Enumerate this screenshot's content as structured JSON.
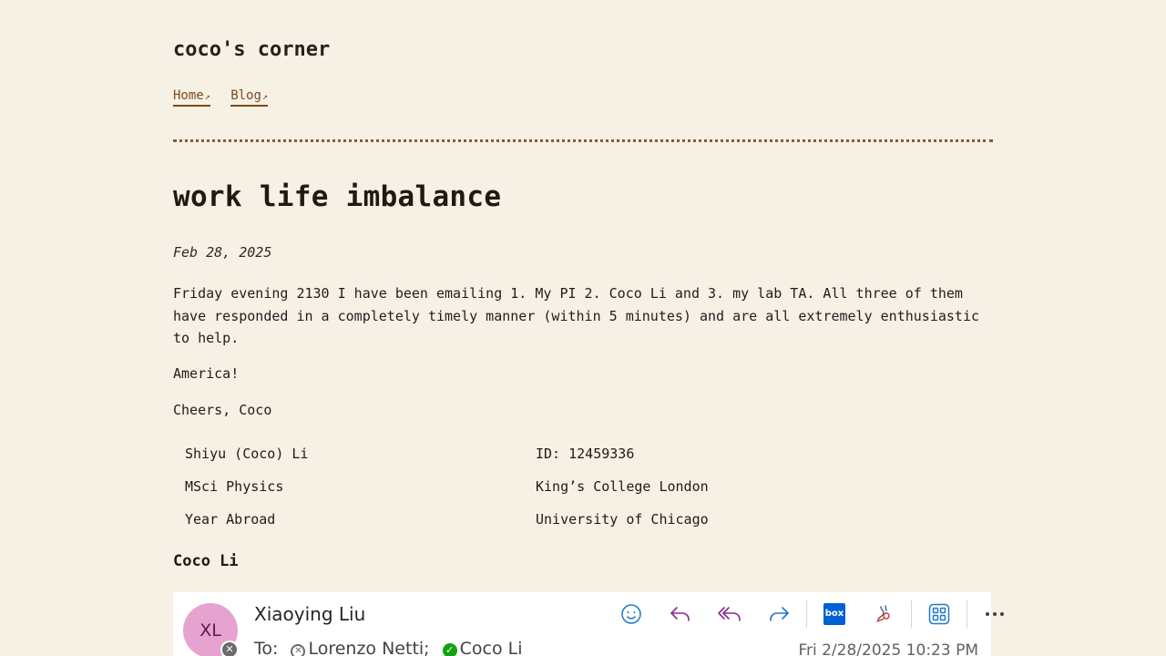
{
  "site": {
    "title": "coco's corner",
    "nav": [
      {
        "label": "Home",
        "ext": "↗"
      },
      {
        "label": "Blog",
        "ext": "↗"
      }
    ]
  },
  "post": {
    "title": "work life imbalance",
    "date": "Feb 28, 2025",
    "paragraphs": [
      "Friday evening 2130 I have been emailing 1. My PI 2. Coco Li and 3. my lab TA. All three of them have responded in a completely timely manner (within 5 minutes) and are all extremely enthusiastic to help.",
      "America!",
      "Cheers, Coco"
    ],
    "info_table": [
      [
        "Shiyu (Coco) Li",
        "ID: 12459336"
      ],
      [
        "MSci Physics",
        "King’s College London"
      ],
      [
        "Year Abroad",
        "University of Chicago"
      ]
    ],
    "signature_heading": "Coco Li"
  },
  "email": {
    "avatar_initials": "XL",
    "sender": "Xiaoying Liu",
    "to_label": "To:",
    "recipients": [
      {
        "name": "Lorenzo Netti;",
        "status": "offline"
      },
      {
        "name": "Coco Li",
        "status": "available"
      }
    ],
    "timestamp": "Fri 2/28/2025 10:23 PM",
    "toolbar": [
      "emoji-icon",
      "reply-icon",
      "reply-all-icon",
      "forward-icon",
      "box-icon",
      "sign-icon",
      "apps-icon",
      "more-icon"
    ],
    "box_label": "box",
    "colors": {
      "reply": "#8a2c8f",
      "forward": "#1f78c8",
      "accent": "#0078d4"
    }
  }
}
